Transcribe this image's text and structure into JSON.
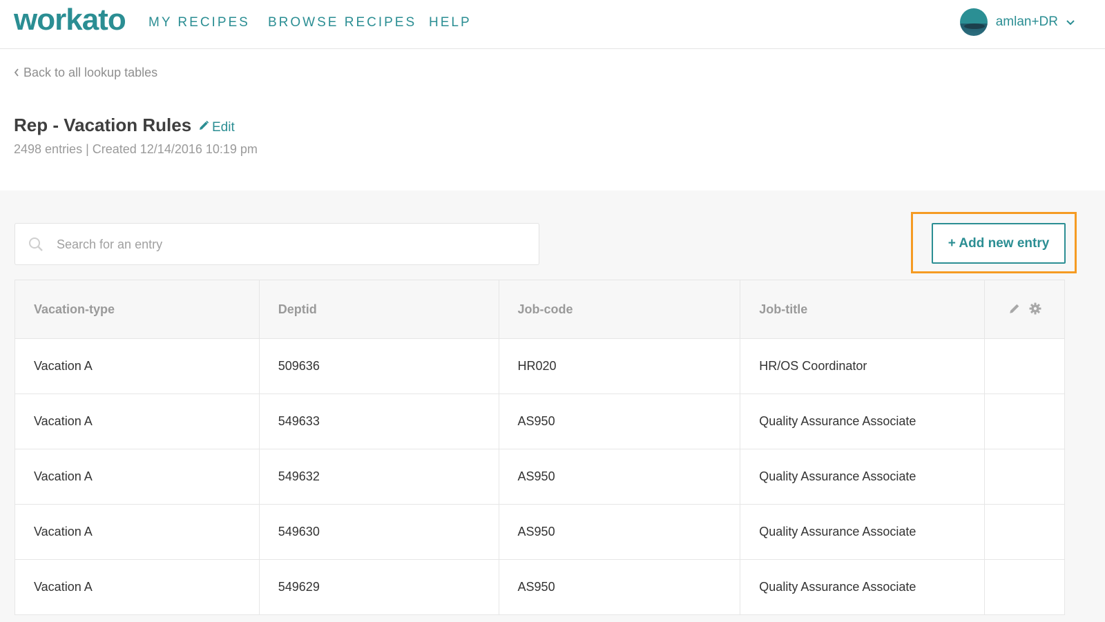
{
  "nav": {
    "logo": "workato",
    "links": [
      "MY RECIPES",
      "BROWSE RECIPES",
      "HELP"
    ],
    "username": "amlan+DR",
    "chevron": "⌄"
  },
  "header": {
    "back_label": "Back to all lookup tables",
    "title": "Rep - Vacation Rules",
    "edit_label": "Edit",
    "meta": "2498 entries | Created 12/14/2016 10:19 pm"
  },
  "toolbar": {
    "search_placeholder": "Search for an entry",
    "add_label": "+ Add new entry"
  },
  "table": {
    "columns": [
      "Vacation-type",
      "Deptid",
      "Job-code",
      "Job-title"
    ],
    "rows": [
      [
        "Vacation A",
        "509636",
        "HR020",
        "HR/OS Coordinator"
      ],
      [
        "Vacation A",
        "549633",
        "AS950",
        "Quality Assurance Associate"
      ],
      [
        "Vacation A",
        "549632",
        "AS950",
        "Quality Assurance Associate"
      ],
      [
        "Vacation A",
        "549630",
        "AS950",
        "Quality Assurance Associate"
      ],
      [
        "Vacation A",
        "549629",
        "AS950",
        "Quality Assurance Associate"
      ]
    ]
  },
  "colors": {
    "brand": "#2b8e93",
    "highlight": "#f59b23"
  },
  "icons": [
    "search-icon",
    "pencil-icon",
    "gear-icon",
    "chevron-left-icon",
    "chevron-down-icon"
  ]
}
